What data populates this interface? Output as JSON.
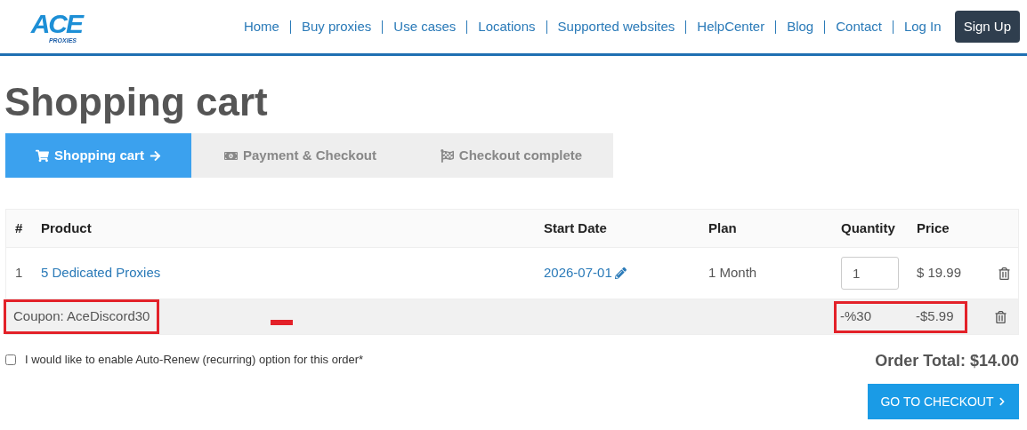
{
  "header": {
    "logo": {
      "main": "ACE",
      "sub": "PROXIES"
    },
    "nav": [
      "Home",
      "Buy proxies",
      "Use cases",
      "Locations",
      "Supported websites",
      "HelpCenter",
      "Blog",
      "Contact",
      "Log In"
    ],
    "sign_up": "Sign Up"
  },
  "title": "Shopping cart",
  "steps": [
    {
      "label": "Shopping cart",
      "selected": true
    },
    {
      "label": "Payment & Checkout",
      "selected": false
    },
    {
      "label": "Checkout complete",
      "selected": false
    }
  ],
  "table": {
    "columns": [
      "#",
      "Product",
      "Start Date",
      "Plan",
      "Quantity",
      "Price"
    ],
    "rows": [
      {
        "index": "1",
        "product": "5 Dedicated Proxies",
        "start_date": "2026-07-01",
        "plan": "1 Month",
        "quantity": "1",
        "price": "$ 19.99"
      }
    ],
    "coupon": {
      "label": "Coupon: AceDiscord30",
      "percent": "-%30",
      "amount": "-$5.99",
      "highlighted": true
    }
  },
  "auto_renew": {
    "label": "I would like to enable Auto-Renew (recurring) option for this order*",
    "checked": false
  },
  "order_total": "Order Total: $14.00",
  "checkout_button": "GO TO CHECKOUT"
}
